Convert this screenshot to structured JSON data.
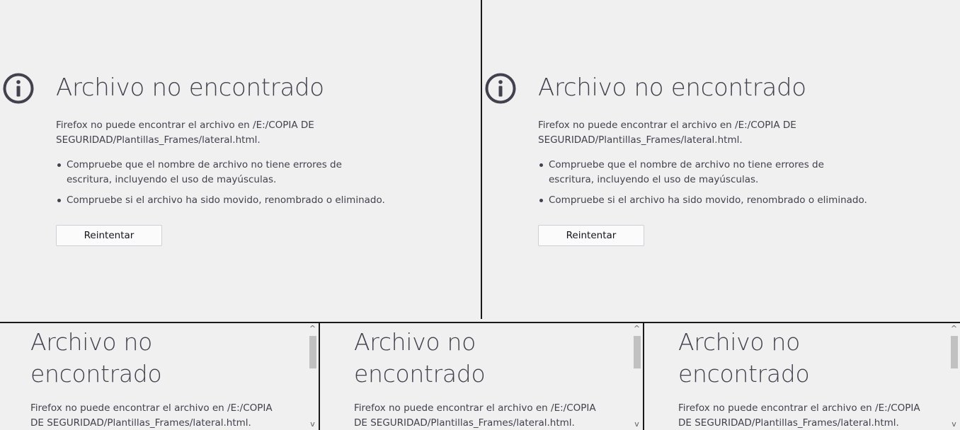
{
  "error_page": {
    "title": "Archivo no encontrado",
    "description": "Firefox no puede encontrar el archivo en /E:/COPIA DE SEGURIDAD/Plantillas_Frames/lateral.html.",
    "checks": [
      "Compruebe que el nombre de archivo no tiene errores de escritura, incluyendo el uso de mayúsculas.",
      "Compruebe si el archivo ha sido movido, renombrado o eliminado."
    ],
    "retry_label": "Reintentar",
    "icon": "info-icon"
  },
  "small_frame": {
    "title": "Archivo no encontrado",
    "description": "Firefox no puede encontrar el archivo en /E:/COPIA DE SEGURIDAD/Plantillas_Frames/lateral.html."
  },
  "scrollbar": {
    "up_arrow": "^",
    "down_arrow": "v"
  }
}
